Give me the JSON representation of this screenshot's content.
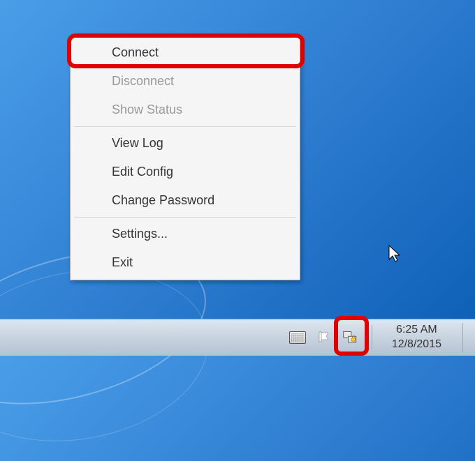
{
  "context_menu": {
    "items": [
      {
        "label": "Connect",
        "enabled": true
      },
      {
        "label": "Disconnect",
        "enabled": false
      },
      {
        "label": "Show Status",
        "enabled": false
      },
      {
        "label": "View Log",
        "enabled": true
      },
      {
        "label": "Edit Config",
        "enabled": true
      },
      {
        "label": "Change Password",
        "enabled": true
      },
      {
        "label": "Settings...",
        "enabled": true
      },
      {
        "label": "Exit",
        "enabled": true
      }
    ]
  },
  "taskbar": {
    "time": "6:25 AM",
    "date": "12/8/2015"
  }
}
